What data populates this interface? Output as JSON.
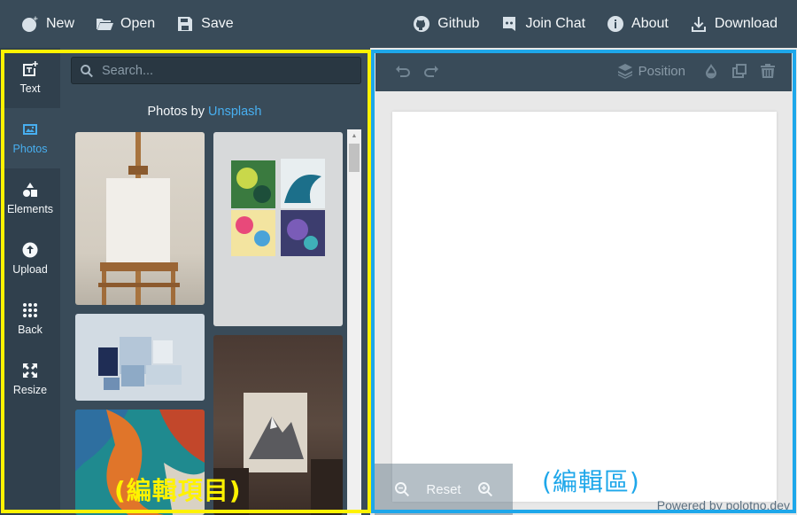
{
  "topbar": {
    "left": [
      {
        "label": "New",
        "icon": "new-icon"
      },
      {
        "label": "Open",
        "icon": "folder-open-icon"
      },
      {
        "label": "Save",
        "icon": "floppy-disk-icon"
      }
    ],
    "right": [
      {
        "label": "Github",
        "icon": "github-icon"
      },
      {
        "label": "Join Chat",
        "icon": "discord-icon"
      },
      {
        "label": "About",
        "icon": "info-icon"
      },
      {
        "label": "Download",
        "icon": "download-icon"
      }
    ]
  },
  "sidetabs": [
    {
      "label": "Text",
      "icon": "text-icon",
      "active": false
    },
    {
      "label": "Photos",
      "icon": "photo-icon",
      "active": true
    },
    {
      "label": "Elements",
      "icon": "shapes-icon",
      "active": false
    },
    {
      "label": "Upload",
      "icon": "upload-icon",
      "active": false
    },
    {
      "label": "Back",
      "icon": "grid-icon",
      "active": false
    },
    {
      "label": "Resize",
      "icon": "resize-icon",
      "active": false
    }
  ],
  "panel": {
    "search_placeholder": "Search...",
    "credit_prefix": "Photos by ",
    "credit_link": "Unsplash"
  },
  "toolbar": {
    "position_label": "Position"
  },
  "zoom": {
    "reset_label": "Reset"
  },
  "footer": {
    "powered": "Powered by polotno.dev"
  },
  "annotations": {
    "left_caption": "(編輯項目)",
    "right_caption": "(編輯區)"
  },
  "colors": {
    "topbar": "#394b59",
    "active_tab": "#48aff0",
    "frame_left": "#fff200",
    "frame_right": "#1ea7ea"
  }
}
